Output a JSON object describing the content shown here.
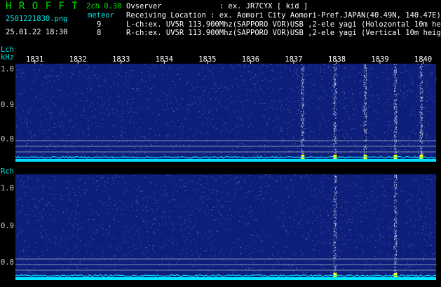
{
  "header": {
    "title": "H R O F F T",
    "mode": "2ch 0.30",
    "filename": "2501221830.png",
    "meteor_label": "meteor",
    "count_l": "9",
    "count_r": "8",
    "datetime": "25.01.22 18:30",
    "observer": "Ovserver             : ex. JR7CYX [ kid ]",
    "location": "Receiving Location : ex. Aomori City Aomori-Pref.JAPAN(40.49N, 140.47E)",
    "lch_info": "L-ch:ex. UV5R 113.900Mhz(SAPPORO VOR)USB ,2-ele yagi (Holozontal 10m height",
    "rch_info": "R-ch:ex. UV5R 113.900Mhz(SAPPORO VOR)USB ,2-ele yagi (Vertical 10m height)"
  },
  "lch": {
    "label": "Lch",
    "unit": "kHz"
  },
  "rch": {
    "label": "Rch"
  },
  "chart_data": {
    "type": "heatmap",
    "x_ticks": [
      "1831",
      "1832",
      "1833",
      "1834",
      "1835",
      "1836",
      "1837",
      "1838",
      "1839",
      "1840"
    ],
    "y_ticks": [
      "1.0",
      "0.9",
      "0.8"
    ],
    "meteor_minutes_l": [
      1837.2,
      1837.95,
      1838.65,
      1839.35,
      1839.95
    ],
    "meteor_minutes_r": [
      1837.95,
      1839.35
    ],
    "colors": {
      "background": "#0d1f7a",
      "noise": "#ffffff",
      "baseline": "#00e5ff",
      "peak": "#ffff00"
    }
  }
}
